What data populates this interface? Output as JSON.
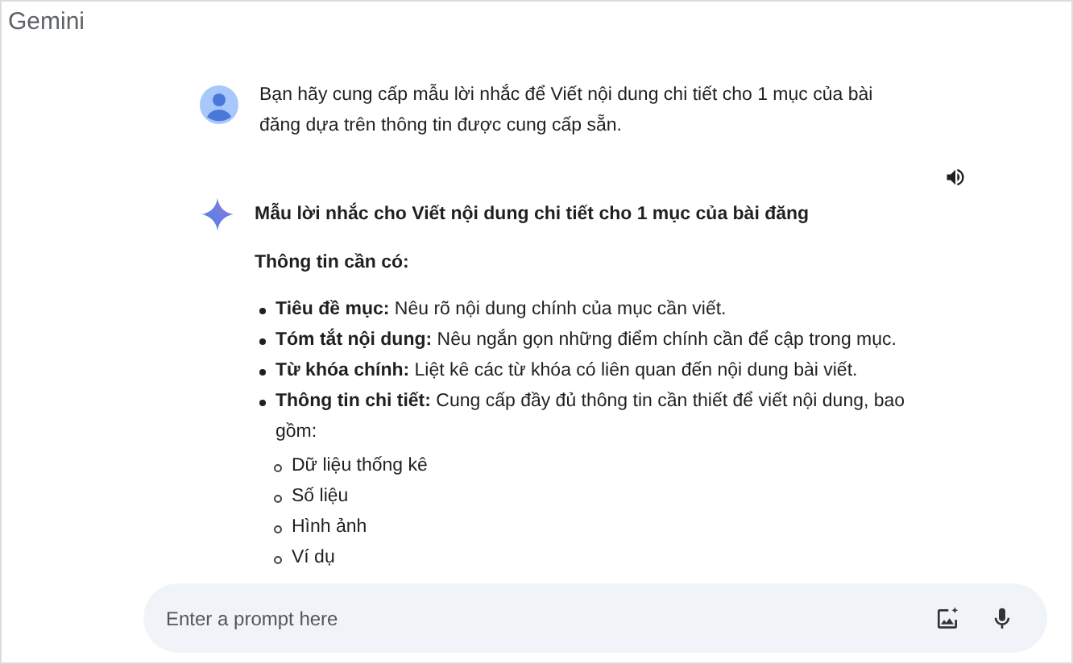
{
  "app": {
    "title": "Gemini"
  },
  "user_message": {
    "text": "Bạn hãy cung cấp mẫu lời nhắc để Viết nội dung chi tiết cho 1 mục của bài đăng dựa trên thông tin được cung cấp sẵn."
  },
  "response": {
    "heading": "Mẫu lời nhắc cho Viết nội dung chi tiết cho 1 mục của bài đăng",
    "subheading": "Thông tin cần có:",
    "items": [
      {
        "text": "**Tiêu đề mục:** Nêu rõ nội dung chính của mục cần viết."
      },
      {
        "text": "**Tóm tắt nội dung:** Nêu ngắn gọn những điểm chính cần để cập trong mục."
      },
      {
        "text": "**Từ khóa chính:** Liệt kê các từ khóa có liên quan đến nội dung bài viết."
      },
      {
        "text": "**Thông tin chi tiết:** Cung cấp đầy đủ thông tin cần thiết để viết nội dung, bao gồm:",
        "children": [
          {
            "text": "Dữ liệu thống kê"
          },
          {
            "text": "Số liệu"
          },
          {
            "text": "Hình ảnh"
          },
          {
            "text": "Ví dụ"
          }
        ]
      }
    ]
  },
  "prompt": {
    "placeholder": "Enter a prompt here"
  }
}
